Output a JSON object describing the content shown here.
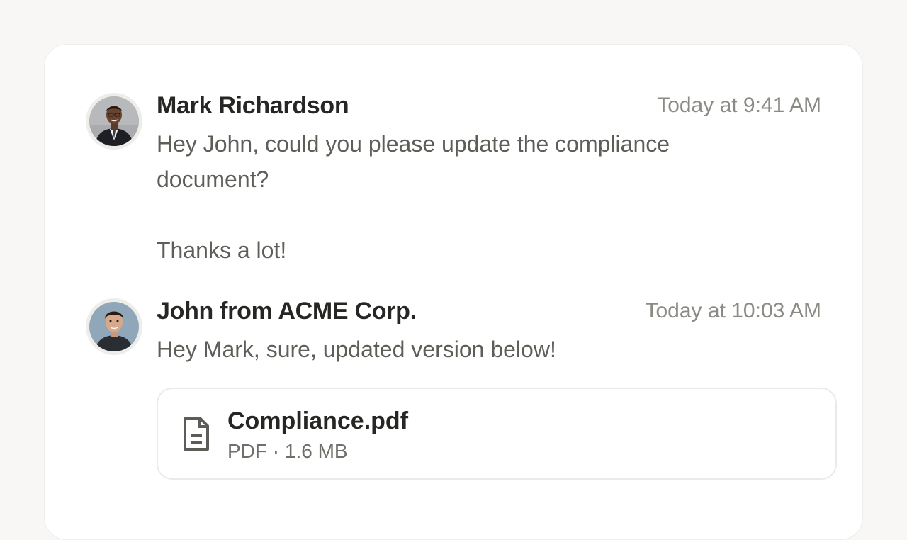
{
  "messages": [
    {
      "sender": "Mark Richardson",
      "timestamp": "Today at 9:41 AM",
      "text": "Hey John, could you please update the compliance document?\n\nThanks a lot!",
      "avatar": "person-avatar-dark-suit"
    },
    {
      "sender": "John from ACME Corp.",
      "timestamp": "Today at 10:03 AM",
      "text": "Hey Mark, sure, updated version below!",
      "avatar": "person-avatar-dark-shirt"
    }
  ],
  "attachment": {
    "file_name": "Compliance.pdf",
    "file_meta": "PDF · 1.6 MB",
    "icon": "document-icon"
  },
  "colors": {
    "page_background": "#f8f7f5",
    "card_background": "#ffffff",
    "sender_text": "#262624",
    "body_text": "#5e5d58",
    "timestamp_text": "#8b8a84",
    "border": "#ebeae6"
  }
}
